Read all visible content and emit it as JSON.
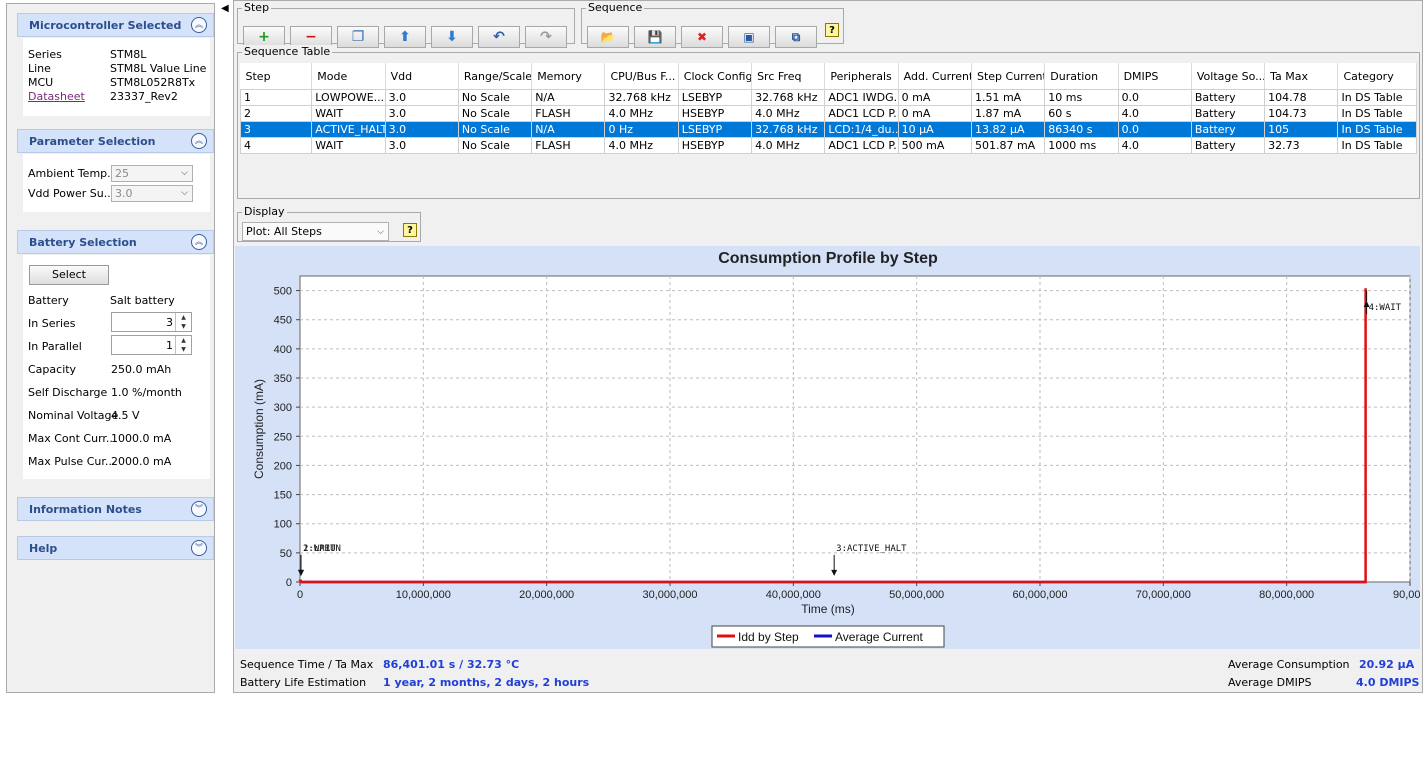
{
  "sidebar": {
    "microcontroller": {
      "title": "Microcontroller Selected",
      "rows": [
        {
          "label": "Series",
          "value": "STM8L"
        },
        {
          "label": "Line",
          "value": "STM8L Value Line"
        },
        {
          "label": "MCU",
          "value": "STM8L052R8Tx"
        },
        {
          "label": "Datasheet",
          "value": "23337_Rev2"
        }
      ]
    },
    "parameters": {
      "title": "Parameter Selection",
      "ambient_label": "Ambient Temp...",
      "ambient_value": "25",
      "vdd_label": "Vdd Power Su...",
      "vdd_value": "3.0"
    },
    "battery": {
      "title": "Battery Selection",
      "select_button": "Select",
      "battery_label": "Battery",
      "battery_value": "Salt battery",
      "in_series_label": "In Series",
      "in_series_value": "3",
      "in_parallel_label": "In Parallel",
      "in_parallel_value": "1",
      "capacity_label": "Capacity",
      "capacity_value": "250.0 mAh",
      "self_discharge_label": "Self Discharge",
      "self_discharge_value": "1.0 %/month",
      "nominal_voltage_label": "Nominal Voltage",
      "nominal_voltage_value": "4.5 V",
      "max_cont_label": "Max Cont Curr...",
      "max_cont_value": "1000.0 mA",
      "max_pulse_label": "Max Pulse Cur...",
      "max_pulse_value": "2000.0 mA"
    },
    "info_notes": {
      "title": "Information Notes"
    },
    "help": {
      "title": "Help"
    }
  },
  "toolbar": {
    "step_group": "Step",
    "sequence_group": "Sequence",
    "step_buttons": [
      {
        "name": "add-step-button",
        "glyph": "+",
        "color": "#1a9c1a",
        "icon": "plus-icon"
      },
      {
        "name": "delete-step-button",
        "glyph": "−",
        "color": "#d01010",
        "icon": "minus-icon"
      },
      {
        "name": "duplicate-step-button",
        "glyph": "❐",
        "color": "#3a6fb5",
        "icon": "copy-icon"
      },
      {
        "name": "move-up-button",
        "glyph": "⬆",
        "color": "#2f7bd0",
        "icon": "arrow-up-icon"
      },
      {
        "name": "move-down-button",
        "glyph": "⬇",
        "color": "#2f7bd0",
        "icon": "arrow-down-icon"
      },
      {
        "name": "undo-button",
        "glyph": "↶",
        "color": "#2f5faa",
        "icon": "undo-icon"
      },
      {
        "name": "redo-button",
        "glyph": "↷",
        "color": "#9a9a9a",
        "icon": "redo-icon"
      }
    ],
    "sequence_buttons": [
      {
        "name": "open-sequence-button",
        "glyph": "📂",
        "color": "#d9a400",
        "icon": "folder-icon"
      },
      {
        "name": "save-sequence-button",
        "glyph": "💾",
        "color": "#2f5faa",
        "icon": "save-icon"
      },
      {
        "name": "delete-sequence-button",
        "glyph": "✖",
        "color": "#e02020",
        "icon": "close-icon"
      },
      {
        "name": "load-sequence-button",
        "glyph": "▣",
        "color": "#2a5aa0",
        "icon": "monitor-icon"
      },
      {
        "name": "compare-sequence-button",
        "glyph": "⧉",
        "color": "#2a5aa0",
        "icon": "compare-icon"
      }
    ],
    "help_glyph": "?"
  },
  "sequence_table": {
    "label": "Sequence Table",
    "columns": [
      "Step",
      "Mode",
      "Vdd",
      "Range/Scale",
      "Memory",
      "CPU/Bus F...",
      "Clock Config",
      "Src Freq",
      "Peripherals",
      "Add. Current",
      "Step Current",
      "Duration",
      "DMIPS",
      "Voltage So...",
      "Ta Max",
      "Category"
    ],
    "rows": [
      [
        "1",
        "LOWPOWE...",
        "3.0",
        "No Scale",
        "N/A",
        "32.768 kHz",
        "LSEBYP",
        "32.768 kHz",
        "ADC1 IWDG...",
        "0 mA",
        "1.51 mA",
        "10 ms",
        "0.0",
        "Battery",
        "104.78",
        "In DS Table"
      ],
      [
        "2",
        "WAIT",
        "3.0",
        "No Scale",
        "FLASH",
        "4.0 MHz",
        "HSEBYP",
        "4.0 MHz",
        "ADC1 LCD P...",
        "0 mA",
        "1.87 mA",
        "60 s",
        "4.0",
        "Battery",
        "104.73",
        "In DS Table"
      ],
      [
        "3",
        "ACTIVE_HALT",
        "3.0",
        "No Scale",
        "N/A",
        "0 Hz",
        "LSEBYP",
        "32.768 kHz",
        "LCD:1/4_du...",
        "10 µA",
        "13.82 µA",
        "86340 s",
        "0.0",
        "Battery",
        "105",
        "In DS Table"
      ],
      [
        "4",
        "WAIT",
        "3.0",
        "No Scale",
        "FLASH",
        "4.0 MHz",
        "HSEBYP",
        "4.0 MHz",
        "ADC1 LCD P...",
        "500 mA",
        "501.87 mA",
        "1000 ms",
        "4.0",
        "Battery",
        "32.73",
        "In DS Table"
      ]
    ],
    "selected_row": 2
  },
  "display": {
    "label": "Display",
    "plot_value": "Plot: All Steps",
    "help_glyph": "?"
  },
  "chart_data": {
    "type": "line",
    "title": "Consumption Profile by Step",
    "xlabel": "Time (ms)",
    "ylabel": "Consumption (mA)",
    "xlim": [
      0,
      90000000
    ],
    "ylim": [
      0,
      525
    ],
    "xticks": [
      0,
      10000000,
      20000000,
      30000000,
      40000000,
      50000000,
      60000000,
      70000000,
      80000000,
      90000000
    ],
    "xtick_labels": [
      "0",
      "10,000,000",
      "20,000,000",
      "30,000,000",
      "40,000,000",
      "50,000,000",
      "60,000,000",
      "70,000,000",
      "80,000,000",
      "90,000,0"
    ],
    "yticks": [
      0,
      50,
      100,
      150,
      200,
      250,
      300,
      350,
      400,
      450,
      500
    ],
    "grid": true,
    "legend_position": "bottom-center",
    "series": [
      {
        "name": "Idd by Step",
        "color": "#e01010",
        "x": [
          0,
          10,
          10,
          60010,
          60010,
          86400010,
          86400010,
          86401010,
          86401010
        ],
        "y": [
          1.51,
          1.51,
          1.87,
          1.87,
          0.014,
          0.014,
          501.87,
          501.87,
          0
        ]
      },
      {
        "name": "Average Current",
        "color": "#1010d0",
        "x": [
          0,
          86401010
        ],
        "y": [
          0.021,
          0.021
        ]
      }
    ],
    "annotations": [
      {
        "text": "2:WAIT",
        "x": 10,
        "y": 50
      },
      {
        "text": "1:LPRUN",
        "x": 0,
        "y": 50
      },
      {
        "text": "3:ACTIVE_HALT",
        "x": 43230010,
        "y": 50
      },
      {
        "text": "4:WAIT",
        "x": 86400010,
        "y": 470
      }
    ]
  },
  "status": {
    "seq_time_label": "Sequence Time / Ta Max",
    "seq_time_value": "86,401.01 s / 32.73 °C",
    "battery_life_label": "Battery Life Estimation",
    "battery_life_value": "1 year, 2 months, 2 days, 2 hours",
    "avg_consumption_label": "Average Consumption",
    "avg_consumption_value": "20.92 µA",
    "avg_dmips_label": "Average DMIPS",
    "avg_dmips_value": "4.0 DMIPS"
  }
}
